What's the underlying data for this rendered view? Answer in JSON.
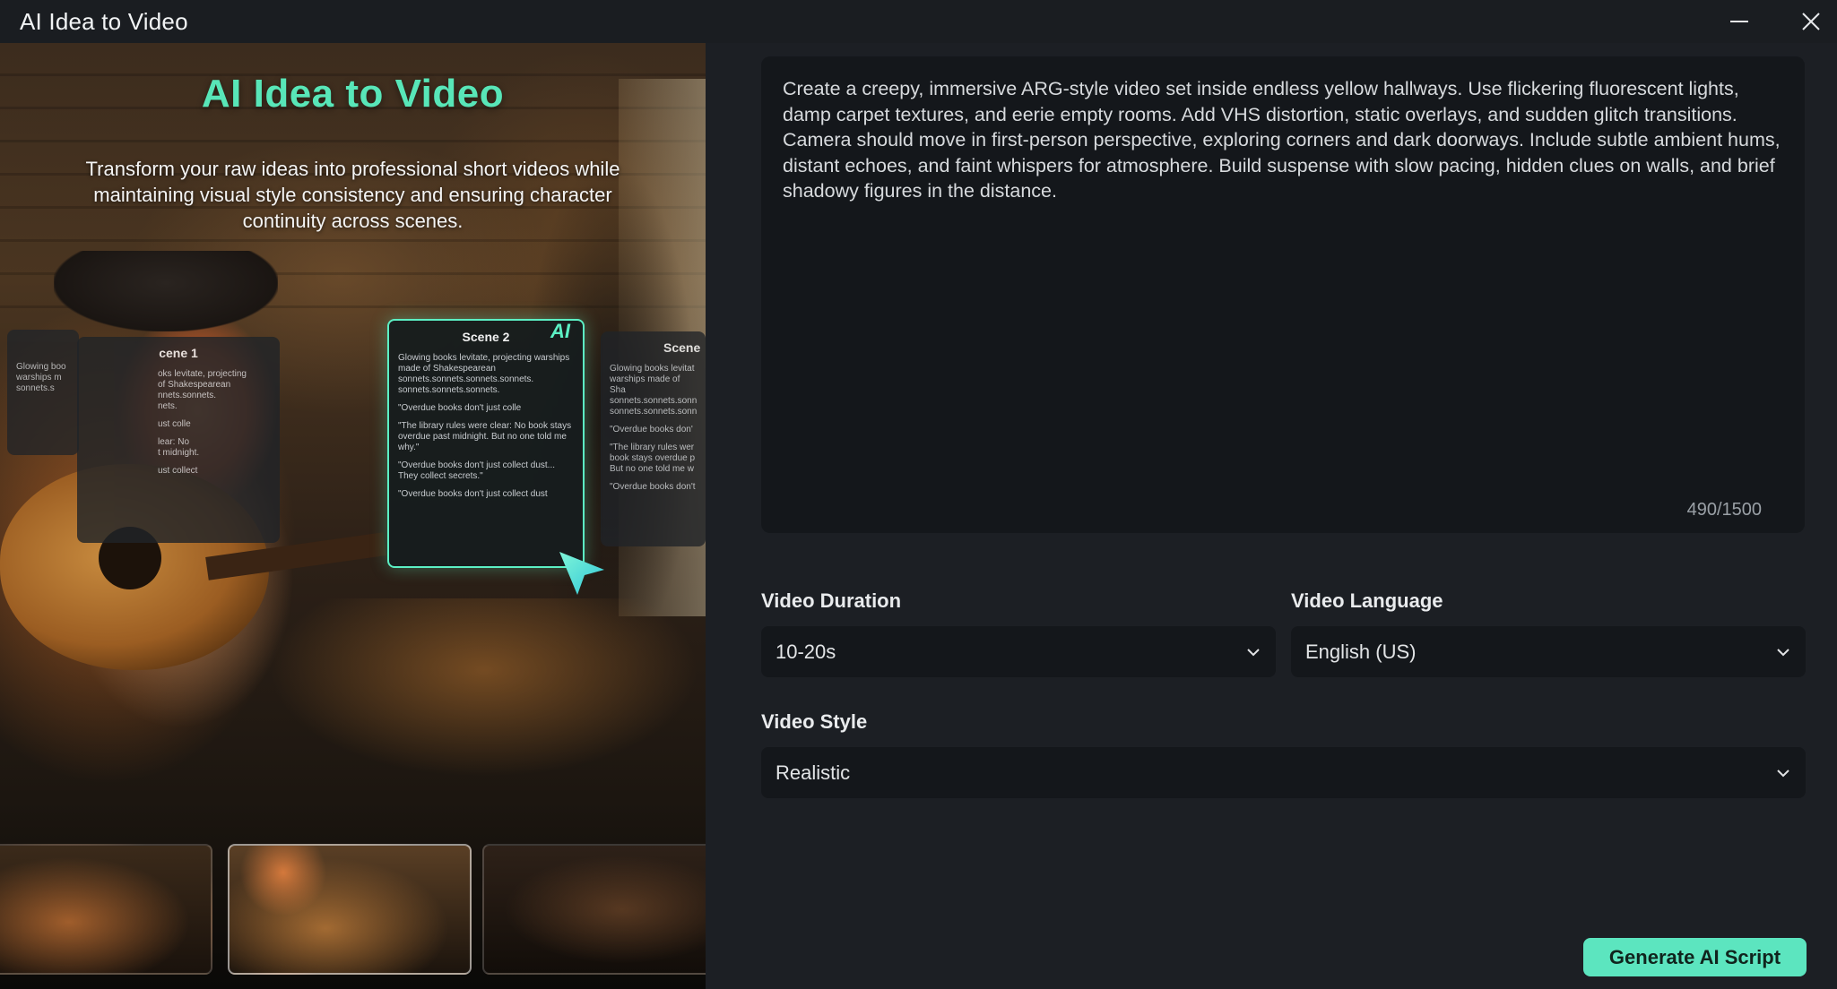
{
  "window": {
    "title": "AI Idea to Video"
  },
  "hero": {
    "title": "AI Idea to Video",
    "subtitle": "Transform your raw ideas into professional short videos while maintaining visual style consistency and ensuring character continuity across scenes.",
    "cards": {
      "scene0": {
        "lines": [
          "Glowing boo",
          "warships m",
          "sonnets.s"
        ]
      },
      "scene1": {
        "title": "cene 1",
        "lines": [
          "oks levitate, projecting",
          "of Shakespearean",
          "nnets.sonnets.",
          "nets.",
          "ust colle",
          "lear: No",
          "t midnight.",
          "ust collect"
        ]
      },
      "scene2": {
        "title": "Scene 2",
        "badge": "AI",
        "p1": "Glowing books levitate, projecting warships made of Shakespearean sonnets.sonnets.sonnets.sonnets. sonnets.sonnets.sonnets.",
        "p2": "\"Overdue books don't just colle",
        "p3": "\"The library rules were clear: No book stays overdue past midnight. But no one told me why.\"",
        "p4": "\"Overdue books don't just collect dust... They collect secrets.\"",
        "p5": "\"Overdue books don't just collect dust"
      },
      "scene3": {
        "title": "Scene",
        "p1": "Glowing books levitat warships made of Sha sonnets.sonnets.sonn sonnets.sonnets.sonn",
        "p2": "\"Overdue books don'",
        "p3": "\"The library rules wer book stays overdue p But no one told me w",
        "p4": "\"Overdue books don't"
      }
    }
  },
  "prompt": {
    "text": "Create a creepy, immersive ARG-style video set inside endless yellow hallways. Use flickering fluorescent lights, damp carpet textures, and eerie empty rooms. Add VHS distortion, static overlays, and sudden glitch transitions. Camera should move in first-person perspective, exploring corners and dark doorways. Include subtle ambient hums, distant echoes, and faint whispers for atmosphere. Build suspense with slow pacing, hidden clues on walls, and brief shadowy figures in the distance.",
    "char_count": "490/1500"
  },
  "options": {
    "duration_label": "Video Duration",
    "duration_value": "10-20s",
    "language_label": "Video Language",
    "language_value": "English (US)",
    "style_label": "Video Style",
    "style_value": "Realistic"
  },
  "actions": {
    "generate_label": "Generate AI Script"
  },
  "colors": {
    "accent": "#5ce5bf",
    "background": "#1c1f24",
    "field": "#14171b"
  }
}
